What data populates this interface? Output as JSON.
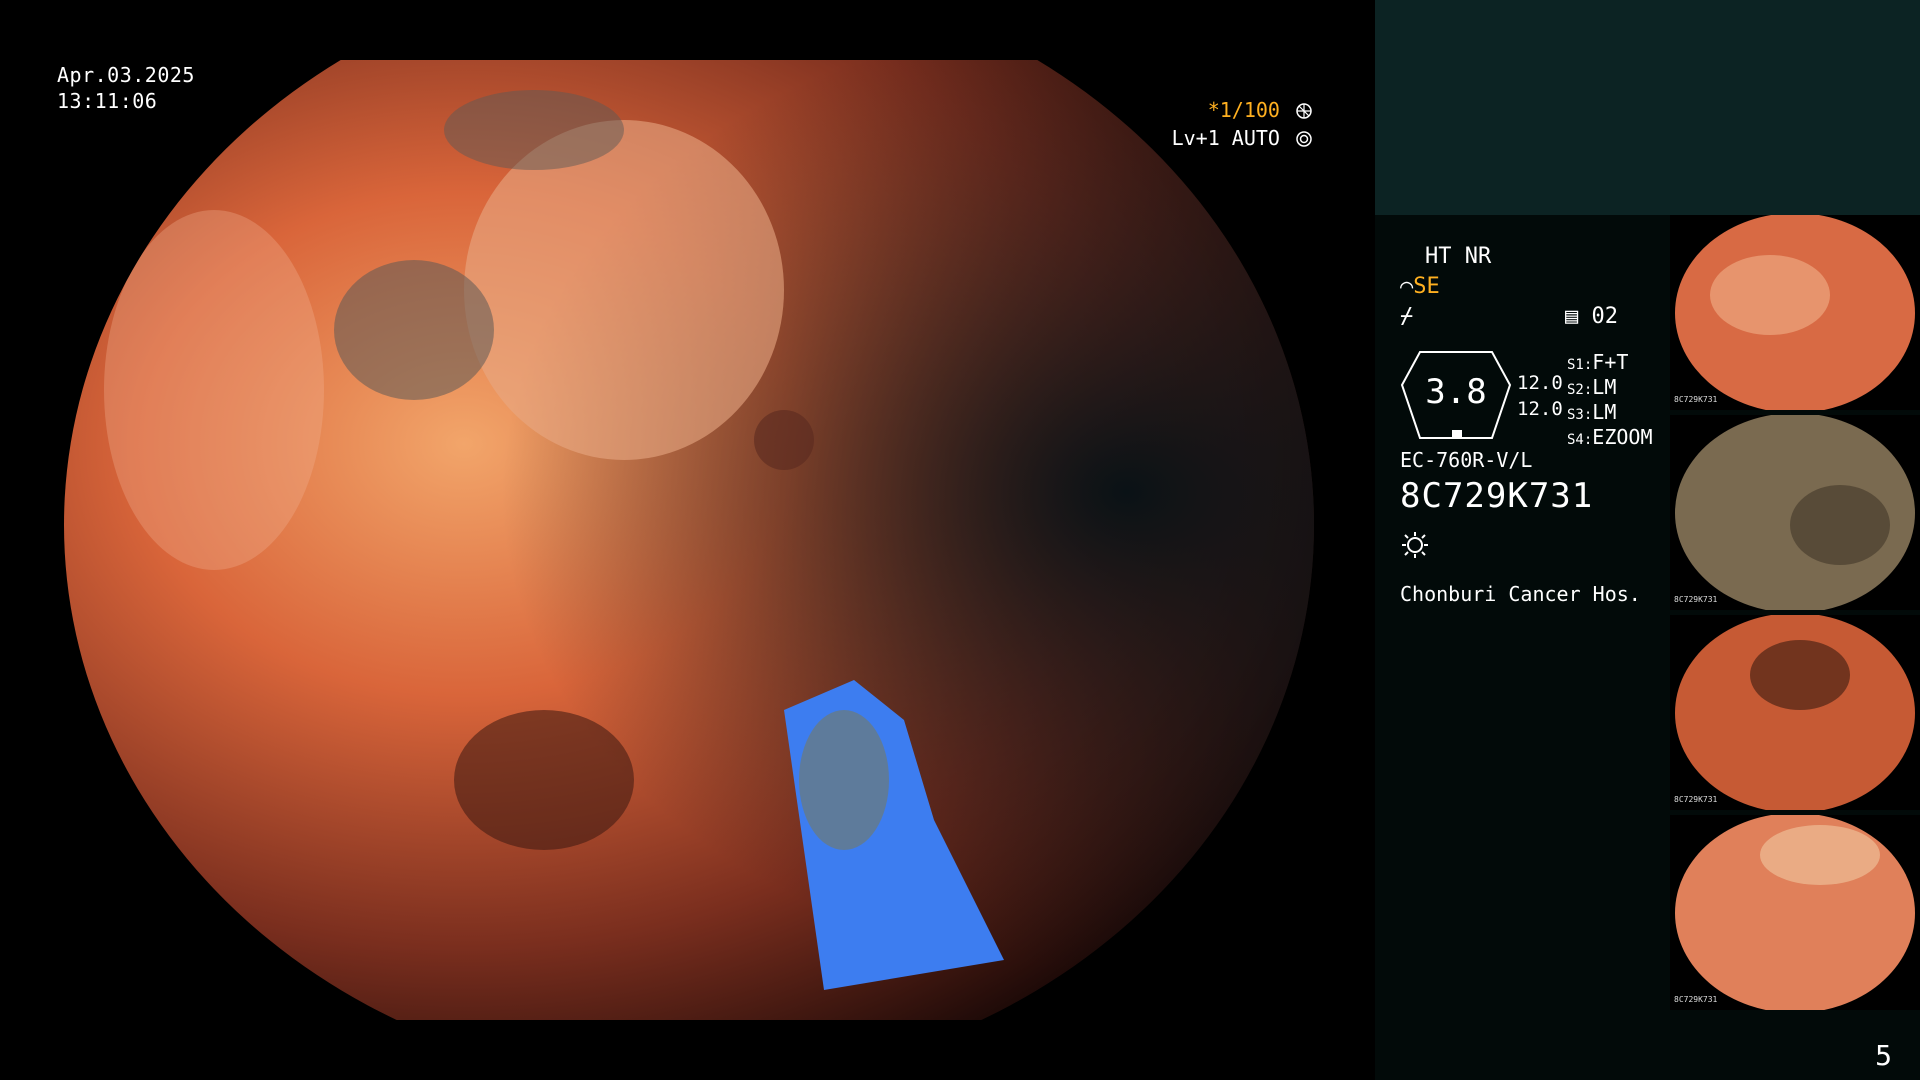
{
  "osd": {
    "date": "Apr.03.2025",
    "time": "13:11:06",
    "shutter": "*1/100",
    "level": "Lv+1 AUTO"
  },
  "panel": {
    "modes": "HT NR",
    "se": "SE",
    "channel": "02",
    "zoom": "3.8",
    "val1": "12.0",
    "val2": "12.0",
    "s1_key": "S1:",
    "s1_val": "F+T",
    "s2_key": "S2:",
    "s2_val": "LM",
    "s3_key": "S3:",
    "s3_val": "LM",
    "s4_key": "S4:",
    "s4_val": "EZOOM",
    "model": "EC-760R-V/L",
    "serial": "8C729K731",
    "hospital": "Chonburi Cancer Hos."
  },
  "thumbnails": [
    {
      "label": "8C729K731"
    },
    {
      "label": "8C729K731"
    },
    {
      "label": "8C729K731"
    },
    {
      "label": "8C729K731"
    }
  ],
  "page": "5",
  "colors": {
    "accent": "#ffb020",
    "panel_top": "#0c2323",
    "panel": "#020a09",
    "probe": "#3d7df0"
  }
}
